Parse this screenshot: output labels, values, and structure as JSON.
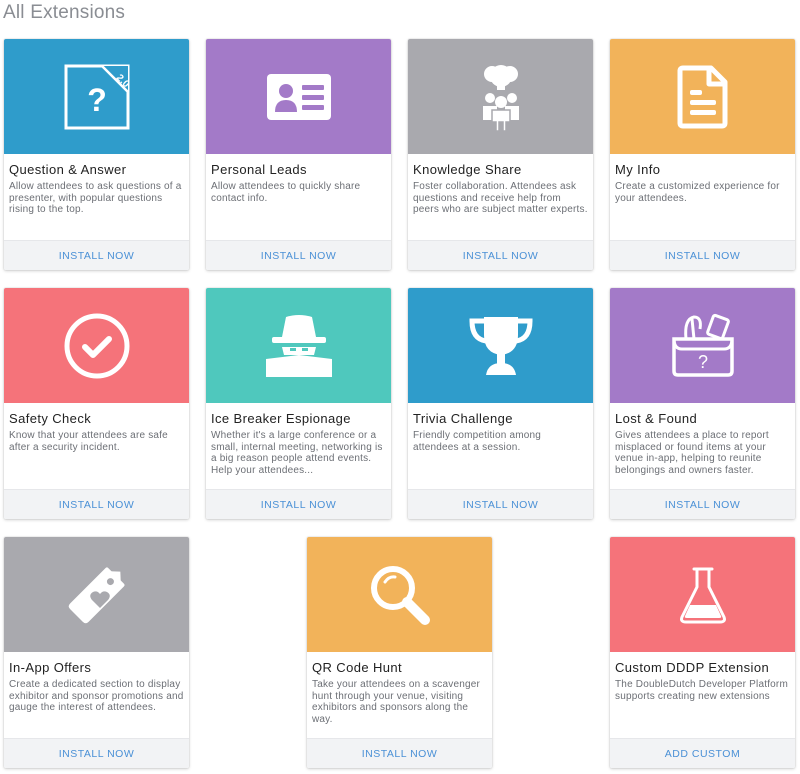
{
  "page": {
    "title": "All Extensions"
  },
  "colors": {
    "blue": "#2f9ccb",
    "purple": "#a37ac8",
    "gray": "#a9a9ae",
    "orange": "#f2b35a",
    "red": "#f5737a",
    "teal": "#4fc8bd",
    "link": "#4a90d6"
  },
  "cards": [
    {
      "title": "Question & Answer",
      "description": "Allow attendees to ask questions of a presenter, with popular questions rising to the top.",
      "action": "INSTALL NOW",
      "icon": "question-board-icon",
      "badge": "2.0"
    },
    {
      "title": "Personal Leads",
      "description": "Allow attendees to quickly share contact info.",
      "action": "INSTALL NOW",
      "icon": "contact-card-icon"
    },
    {
      "title": "Knowledge Share",
      "description": "Foster collaboration. Attendees ask questions and receive help from peers who are subject matter experts.",
      "action": "INSTALL NOW",
      "icon": "idea-people-icon"
    },
    {
      "title": "My Info",
      "description": "Create a customized experience for your attendees.",
      "action": "INSTALL NOW",
      "icon": "document-icon"
    },
    {
      "title": "Safety Check",
      "description": "Know that your attendees are safe after a security incident.",
      "action": "INSTALL NOW",
      "icon": "check-circle-icon"
    },
    {
      "title": "Ice Breaker Espionage",
      "description": "Whether it's a large conference or a small, internal meeting, networking is a big reason people attend events. Help your attendees...",
      "action": "INSTALL NOW",
      "icon": "spy-icon"
    },
    {
      "title": "Trivia Challenge",
      "description": "Friendly competition among attendees at a session.",
      "action": "INSTALL NOW",
      "icon": "trophy-icon"
    },
    {
      "title": "Lost & Found",
      "description": "Gives attendees a place to report misplaced or found items at your venue in-app, helping to reunite belongings and owners faster.",
      "action": "INSTALL NOW",
      "icon": "lost-found-box-icon"
    },
    {
      "title": "In-App Offers",
      "description": "Create a dedicated section to display exhibitor and sponsor promotions and gauge the interest of attendees.",
      "action": "INSTALL NOW",
      "icon": "heart-tag-icon"
    },
    {
      "title": "QR Code Hunt",
      "description": "Take your attendees on a scavenger hunt through your venue, visiting exhibitors and sponsors along the way.",
      "action": "INSTALL NOW",
      "icon": "magnifier-icon"
    },
    {
      "title": "Custom DDDP Extension",
      "description": "The DoubleDutch Developer Platform supports creating new extensions",
      "action": "ADD CUSTOM",
      "icon": "flask-icon"
    }
  ]
}
